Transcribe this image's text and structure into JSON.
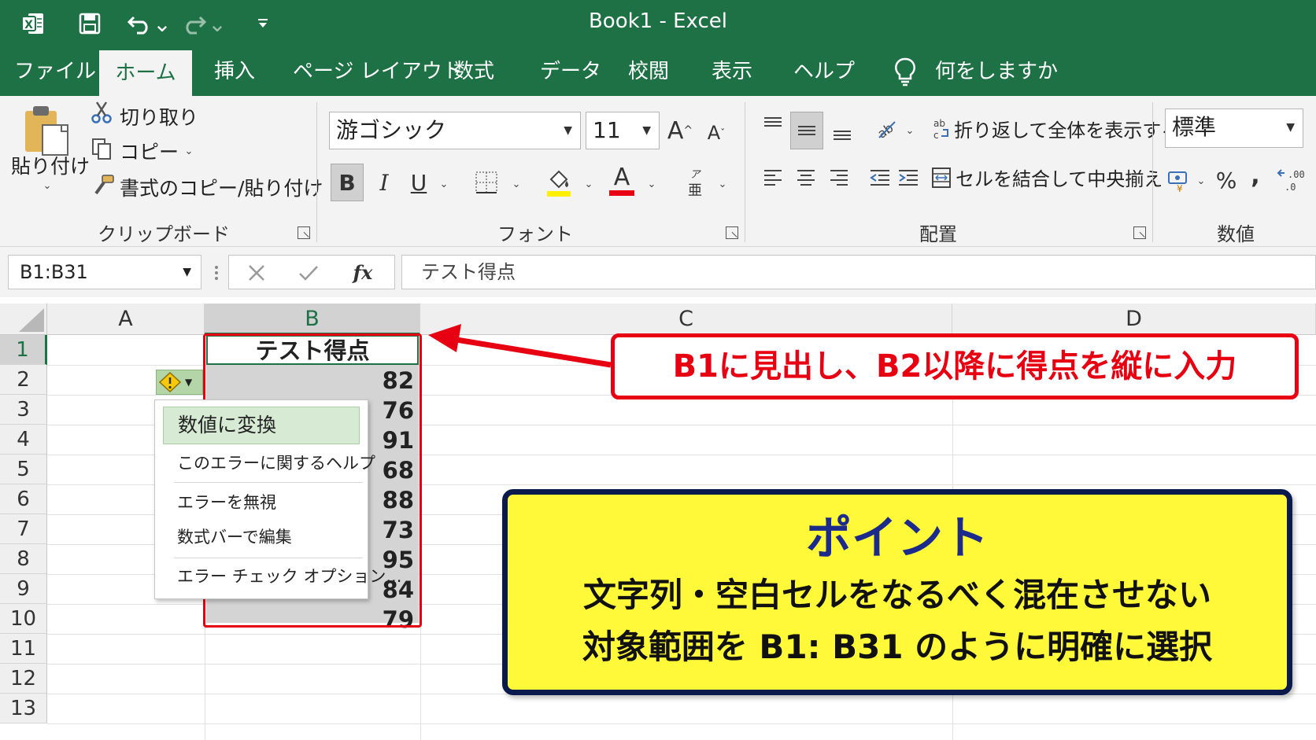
{
  "window": {
    "title": "Book1  -  Excel"
  },
  "menu": {
    "tabs": [
      "ファイル",
      "ホーム",
      "挿入",
      "ページ レイアウト",
      "数式",
      "データ",
      "校閲",
      "表示",
      "ヘルプ"
    ],
    "active_tab": "ホーム",
    "tell_me": "何をしますか"
  },
  "ribbon": {
    "clipboard": {
      "paste": "貼り付け",
      "cut": "切り取り",
      "copy": "コピー",
      "format_painter": "書式のコピー/貼り付け",
      "group_label": "クリップボード"
    },
    "font": {
      "font_name": "游ゴシック",
      "font_size": "11",
      "bold": "B",
      "italic": "I",
      "underline": "U",
      "font_color_glyph": "A",
      "group_label": "フォント"
    },
    "alignment": {
      "wrap_text": "折り返して全体を表示する",
      "merge_center": "セルを結合して中央揃え",
      "group_label": "配置"
    },
    "number": {
      "format": "標準",
      "percent": "%",
      "comma": ",",
      "group_label": "数値"
    }
  },
  "formula_bar": {
    "name_box": "B1:B31",
    "fx": "fx",
    "content": "テスト得点"
  },
  "grid": {
    "columns": [
      "A",
      "B",
      "C",
      "D"
    ],
    "rows": [
      "1",
      "2",
      "3",
      "4",
      "5",
      "6",
      "7",
      "8",
      "9",
      "10",
      "11",
      "12",
      "13"
    ],
    "b1": "テスト得点",
    "b_values": [
      "82",
      "76",
      "91",
      "68",
      "88",
      "73",
      "95",
      "84",
      "79"
    ]
  },
  "error_menu": {
    "items": [
      "数値に変換",
      "このエラーに関するヘルプ",
      "エラーを無視",
      "数式バーで編集",
      "エラー チェック オプション..."
    ]
  },
  "callout": {
    "text": "B1に見出し、B2以降に得点を縦に入力"
  },
  "point_box": {
    "title": "ポイント",
    "line1": "文字列・空白セルをなるべく混在させない",
    "line2": "対象範囲を B1: B31 のように明確に選択"
  },
  "colors": {
    "excel_green": "#1e7145",
    "highlight_red": "#e60012",
    "point_yellow": "#fff93a",
    "point_title_blue": "#1c2a8c",
    "selection_gray": "#d4d4d4"
  }
}
